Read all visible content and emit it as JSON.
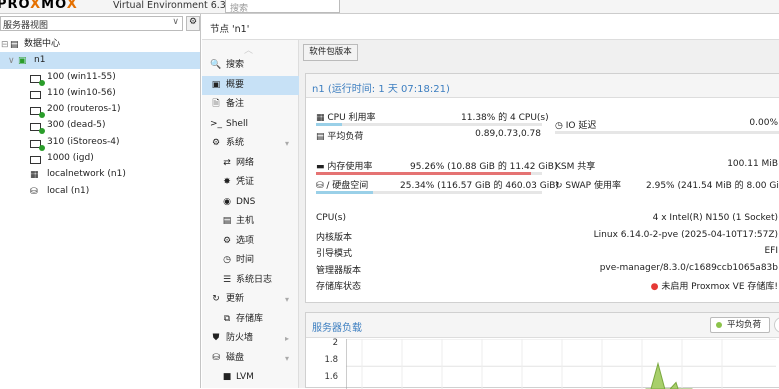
{
  "topbar": {
    "logo_a": "PRO",
    "logo_x": "X",
    "logo_b": "MO",
    "logo_x2": "X",
    "version": "Virtual Environment 6.3.0",
    "search_placeholder": "搜索"
  },
  "view_selector": {
    "value": "服务器视图"
  },
  "tree": [
    {
      "label": "数据中心",
      "icon": "datacenter-icon"
    },
    {
      "label": "n1",
      "icon": "node-icon"
    },
    {
      "label": "100 (win11-55)",
      "icon": "vm-running-icon"
    },
    {
      "label": "110 (win10-56)",
      "icon": "vm-stopped-icon"
    },
    {
      "label": "200 (routeros-1)",
      "icon": "vm-running-icon"
    },
    {
      "label": "300 (dead-5)",
      "icon": "vm-running-icon"
    },
    {
      "label": "310 (iStoreos-4)",
      "icon": "vm-running-icon"
    },
    {
      "label": "1000 (igd)",
      "icon": "vm-stopped-icon"
    },
    {
      "label": "localnetwork (n1)",
      "icon": "network-icon"
    },
    {
      "label": "local (n1)",
      "icon": "storage-icon"
    }
  ],
  "breadcrumb": "节点 'n1'",
  "menu": [
    {
      "label": "搜索",
      "icon": "🔍"
    },
    {
      "label": "概要",
      "icon": "▣"
    },
    {
      "label": "备注",
      "icon": "🗎"
    },
    {
      "label": "Shell",
      "icon": ">_"
    },
    {
      "label": "系统",
      "icon": "⚙"
    },
    {
      "label": "网络",
      "icon": "⇄"
    },
    {
      "label": "凭证",
      "icon": "✸"
    },
    {
      "label": "DNS",
      "icon": "◉"
    },
    {
      "label": "主机",
      "icon": "▤"
    },
    {
      "label": "选项",
      "icon": "⚙"
    },
    {
      "label": "时间",
      "icon": "◷"
    },
    {
      "label": "系统日志",
      "icon": "☰"
    },
    {
      "label": "更新",
      "icon": "↻"
    },
    {
      "label": "存储库",
      "icon": "⧉"
    },
    {
      "label": "防火墙",
      "icon": "⛊"
    },
    {
      "label": "磁盘",
      "icon": "⛁"
    },
    {
      "label": "LVM",
      "icon": "■"
    }
  ],
  "toolbar": {
    "pkg_button": "软件包版本"
  },
  "status": {
    "title": "n1 (运行时间: 1 天 07:18:21)",
    "cpu_label": "CPU 利用率",
    "cpu_value": "11.38% 的 4 CPU(s)",
    "cpu_pct": 11.38,
    "load_label": "平均负荷",
    "load_value": "0.89,0.73,0.78",
    "io_label": "IO 延迟",
    "io_value": "0.00%",
    "mem_label": "内存使用率",
    "mem_value": "95.26% (10.88 GiB 的 11.42 GiB)",
    "mem_pct": 95.26,
    "ksm_label": "KSM 共享",
    "ksm_value": "100.11 MiB",
    "disk_label": "/ 硬盘空间",
    "disk_value": "25.34% (116.57 GiB 的 460.03 GiB)",
    "disk_pct": 25.34,
    "swap_label": "SWAP 使用率",
    "swap_value": "2.95% (241.54 MiB 的 8.00 GiB)",
    "cpus_label": "CPU(s)",
    "cpus_value": "4 x Intel(R) N150 (1 Socket)",
    "kernel_label": "内核版本",
    "kernel_value": "Linux 6.14.0-2-pve (2025-04-10T17:57Z)",
    "boot_label": "引导模式",
    "boot_value": "EFI",
    "mgr_label": "管理器版本",
    "mgr_value": "pve-manager/8.3.0/c1689ccb1065a83b",
    "repo_label": "存储库状态",
    "repo_value": "未启用 Proxmox VE 存储库!",
    "colors": {
      "accent": "#3c7ec0",
      "warn": "#e57373",
      "ok": "#9ad0e8",
      "error": "#e53935"
    }
  },
  "load_panel": {
    "title": "服务器负载",
    "legend": "平均负荷"
  },
  "chart_data": {
    "type": "area",
    "yticks": [
      "2",
      "1.8",
      "1.6"
    ],
    "ylim": [
      1.5,
      2
    ],
    "series": [
      {
        "name": "平均负荷",
        "color": "#8bc34a",
        "x": [
          0,
          1,
          2,
          3,
          4,
          5
        ],
        "values": [
          1.5,
          1.82,
          1.6,
          1.68,
          1.5,
          1.58
        ]
      }
    ]
  }
}
